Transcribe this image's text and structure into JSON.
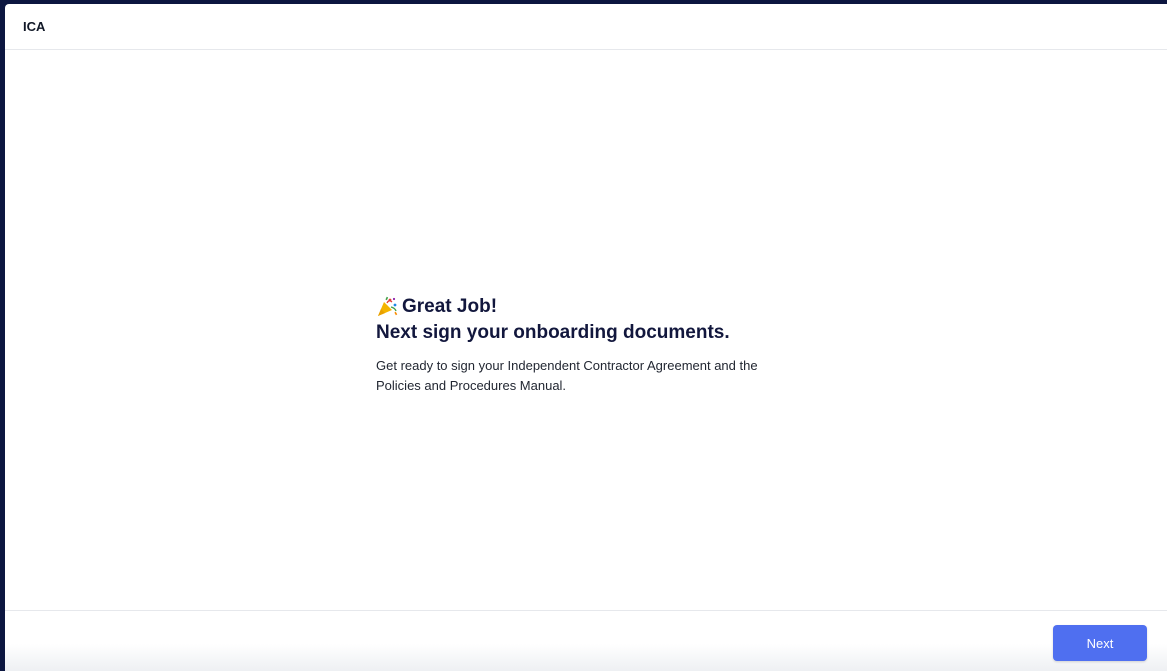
{
  "header": {
    "title": "ICA"
  },
  "main": {
    "icon": "party-popper-icon",
    "heading_line_1": "Great Job!",
    "heading_line_2": "Next sign your onboarding documents.",
    "description_line_1": "Get ready to sign your Independent Contractor Agreement and the",
    "description_line_2": "Policies and Procedures Manual."
  },
  "footer": {
    "next_label": "Next"
  },
  "colors": {
    "outer_background": "#0c1640",
    "heading_text": "#12173d",
    "primary_button": "#4f6ff0"
  }
}
